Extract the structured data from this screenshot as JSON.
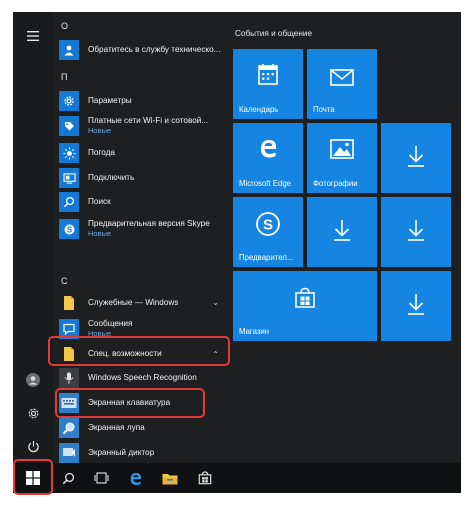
{
  "applist": {
    "groups": [
      {
        "letter": "О"
      },
      {
        "letter": "П"
      },
      {
        "letter": "С"
      }
    ],
    "apps": {
      "feedback": {
        "name": "Обратитесь в службу техническо..."
      },
      "settings": {
        "name": "Параметры"
      },
      "wifi": {
        "name": "Платные сети Wi-Fi и сотовой...",
        "badge": "Новые"
      },
      "weather": {
        "name": "Погода"
      },
      "connect": {
        "name": "Подключить"
      },
      "search": {
        "name": "Поиск"
      },
      "skype": {
        "name": "Предварительная версия Skype",
        "badge": "Новые"
      },
      "system_tools": {
        "name": "Служебные — Windows"
      },
      "messages": {
        "name": "Сообщения",
        "badge": "Новые"
      },
      "accessibility": {
        "name": "Спец. возможности"
      },
      "speech": {
        "name": "Windows Speech Recognition"
      },
      "osk": {
        "name": "Экранная клавиатура"
      },
      "magnifier": {
        "name": "Экранная лупа"
      },
      "narrator": {
        "name": "Экранный диктор"
      }
    }
  },
  "tiles": {
    "group_title": "События и общение",
    "items": {
      "calendar": {
        "label": "Календарь"
      },
      "mail": {
        "label": "Почта"
      },
      "edge": {
        "label": "Microsoft Edge"
      },
      "photos": {
        "label": "Фотографии"
      },
      "skype": {
        "label": "Предварител..."
      },
      "store": {
        "label": "Магазин"
      }
    }
  },
  "colors": {
    "accent": "#1685e1",
    "menu_bg": "#1e1f21",
    "taskbar_bg": "#101113",
    "highlight": "#e03a3a",
    "badge": "#69a8e6"
  },
  "icons": [
    "hamburger-icon",
    "user-icon",
    "gear-icon",
    "power-icon",
    "windows-logo-icon",
    "search-icon",
    "task-view-icon",
    "edge-icon",
    "file-explorer-icon",
    "store-icon",
    "download-icon"
  ]
}
